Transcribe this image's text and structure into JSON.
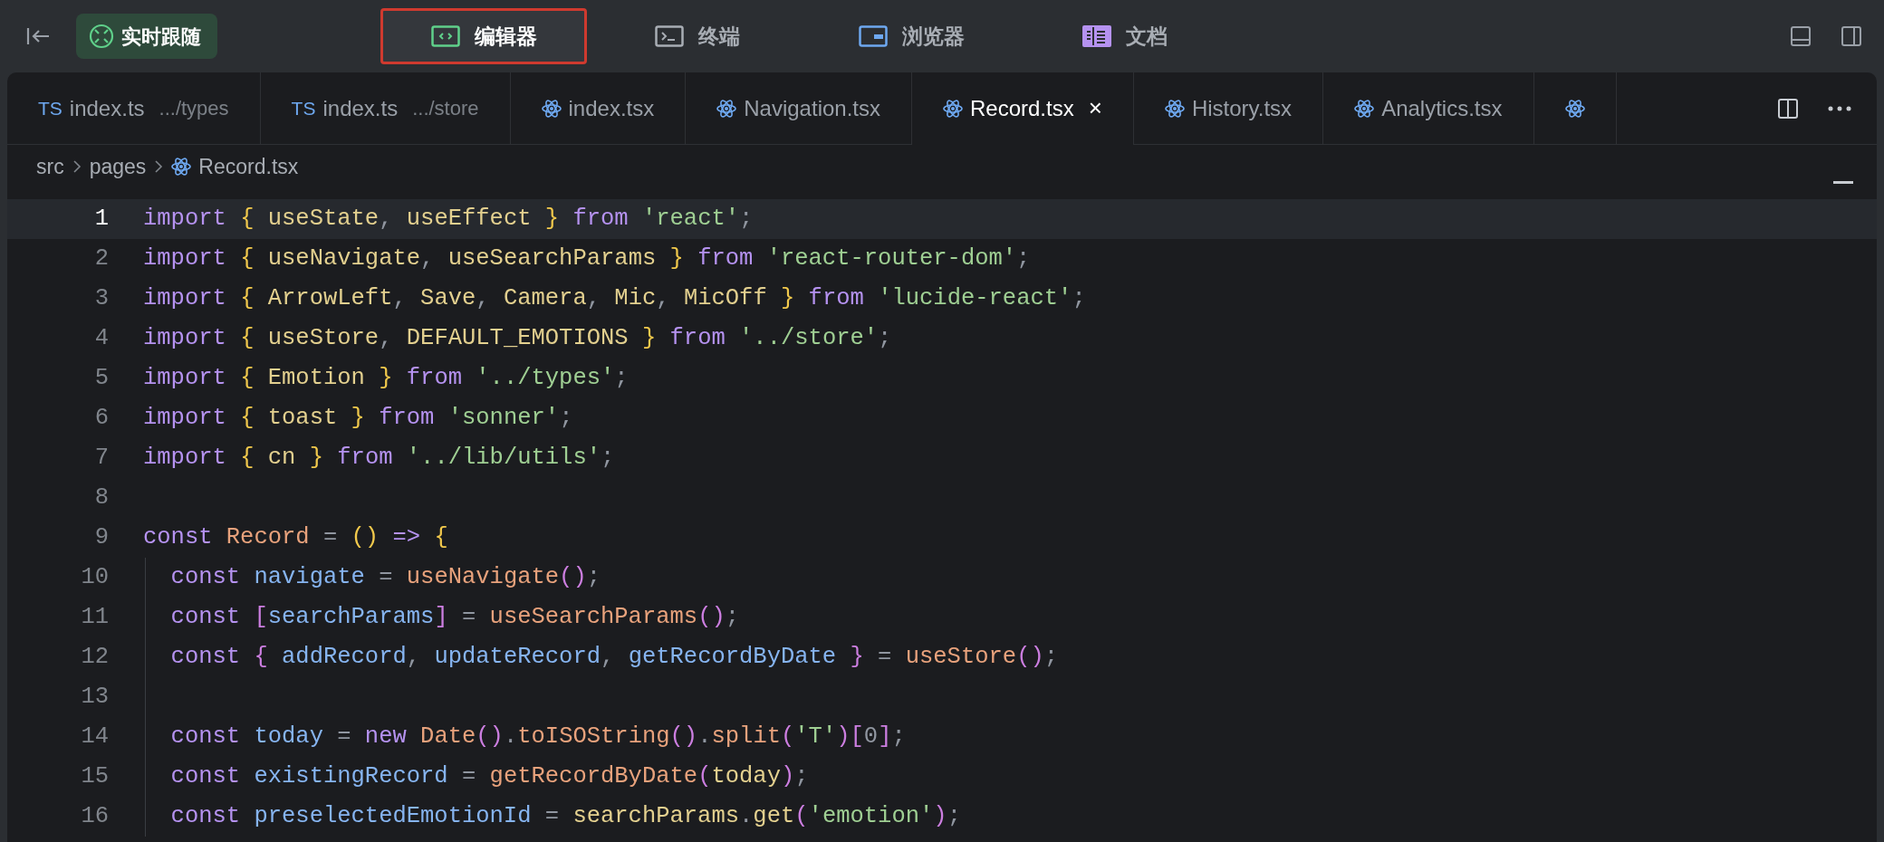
{
  "toolbar": {
    "follow_button": "实时跟随",
    "view_tabs": [
      {
        "kind": "editor",
        "label": "编辑器",
        "selected": true
      },
      {
        "kind": "terminal",
        "label": "终端",
        "selected": false
      },
      {
        "kind": "browser",
        "label": "浏览器",
        "selected": false
      },
      {
        "kind": "docs",
        "label": "文档",
        "selected": false
      }
    ]
  },
  "file_tabs": [
    {
      "kind": "ts",
      "badge": "TS",
      "label": "index.ts",
      "hint": ".../types",
      "selected": false
    },
    {
      "kind": "ts",
      "badge": "TS",
      "label": "index.ts",
      "hint": ".../store",
      "selected": false
    },
    {
      "kind": "react",
      "label": "index.tsx",
      "selected": false
    },
    {
      "kind": "react",
      "label": "Navigation.tsx",
      "selected": false
    },
    {
      "kind": "react",
      "label": "Record.tsx",
      "selected": true,
      "close": "×"
    },
    {
      "kind": "react",
      "label": "History.tsx",
      "selected": false
    },
    {
      "kind": "react",
      "label": "Analytics.tsx",
      "selected": false
    },
    {
      "kind": "react",
      "selected": false
    }
  ],
  "breadcrumb": [
    "src",
    "pages",
    "Record.tsx"
  ],
  "code": [
    {
      "n": "1",
      "selected": true,
      "tokens": [
        {
          "text": "import",
          "kind": "keyword"
        },
        {
          "text": " {",
          "kind": "brace"
        },
        {
          "text": " useState",
          "kind": "name"
        },
        {
          "text": ",",
          "kind": "punct"
        },
        {
          "text": " useEffect",
          "kind": "name"
        },
        {
          "text": " }",
          "kind": "brace"
        },
        {
          "text": " from",
          "kind": "keyword"
        },
        {
          "text": " 'react'",
          "kind": "string"
        },
        {
          "text": ";",
          "kind": "punct"
        }
      ]
    },
    {
      "n": "2",
      "selected": false,
      "tokens": [
        {
          "text": "import",
          "kind": "keyword"
        },
        {
          "text": " {",
          "kind": "brace"
        },
        {
          "text": " useNavigate",
          "kind": "name"
        },
        {
          "text": ",",
          "kind": "punct"
        },
        {
          "text": " useSearchParams",
          "kind": "name"
        },
        {
          "text": " }",
          "kind": "brace"
        },
        {
          "text": " from",
          "kind": "keyword"
        },
        {
          "text": " 'react-router-dom'",
          "kind": "string"
        },
        {
          "text": ";",
          "kind": "punct"
        }
      ]
    },
    {
      "n": "3",
      "selected": false,
      "tokens": [
        {
          "text": "import",
          "kind": "keyword"
        },
        {
          "text": " {",
          "kind": "brace"
        },
        {
          "text": " ArrowLeft",
          "kind": "name"
        },
        {
          "text": ",",
          "kind": "punct"
        },
        {
          "text": " Save",
          "kind": "name"
        },
        {
          "text": ",",
          "kind": "punct"
        },
        {
          "text": " Camera",
          "kind": "name"
        },
        {
          "text": ",",
          "kind": "punct"
        },
        {
          "text": " Mic",
          "kind": "name"
        },
        {
          "text": ",",
          "kind": "punct"
        },
        {
          "text": " MicOff",
          "kind": "name"
        },
        {
          "text": " }",
          "kind": "brace"
        },
        {
          "text": " from",
          "kind": "keyword"
        },
        {
          "text": " 'lucide-react'",
          "kind": "string"
        },
        {
          "text": ";",
          "kind": "punct"
        }
      ]
    },
    {
      "n": "4",
      "selected": false,
      "tokens": [
        {
          "text": "import",
          "kind": "keyword"
        },
        {
          "text": " {",
          "kind": "brace"
        },
        {
          "text": " useStore",
          "kind": "name"
        },
        {
          "text": ",",
          "kind": "punct"
        },
        {
          "text": " DEFAULT_EMOTIONS",
          "kind": "name"
        },
        {
          "text": " }",
          "kind": "brace"
        },
        {
          "text": " from",
          "kind": "keyword"
        },
        {
          "text": " '../store'",
          "kind": "string"
        },
        {
          "text": ";",
          "kind": "punct"
        }
      ]
    },
    {
      "n": "5",
      "selected": false,
      "tokens": [
        {
          "text": "import",
          "kind": "keyword"
        },
        {
          "text": " {",
          "kind": "brace"
        },
        {
          "text": " Emotion",
          "kind": "name"
        },
        {
          "text": " }",
          "kind": "brace"
        },
        {
          "text": " from",
          "kind": "keyword"
        },
        {
          "text": " '../types'",
          "kind": "string"
        },
        {
          "text": ";",
          "kind": "punct"
        }
      ]
    },
    {
      "n": "6",
      "selected": false,
      "tokens": [
        {
          "text": "import",
          "kind": "keyword"
        },
        {
          "text": " {",
          "kind": "brace"
        },
        {
          "text": " toast",
          "kind": "name"
        },
        {
          "text": " }",
          "kind": "brace"
        },
        {
          "text": " from",
          "kind": "keyword"
        },
        {
          "text": " 'sonner'",
          "kind": "string"
        },
        {
          "text": ";",
          "kind": "punct"
        }
      ]
    },
    {
      "n": "7",
      "selected": false,
      "tokens": [
        {
          "text": "import",
          "kind": "keyword"
        },
        {
          "text": " {",
          "kind": "brace"
        },
        {
          "text": " cn",
          "kind": "name"
        },
        {
          "text": " }",
          "kind": "brace"
        },
        {
          "text": " from",
          "kind": "keyword"
        },
        {
          "text": " '../lib/utils'",
          "kind": "string"
        },
        {
          "text": ";",
          "kind": "punct"
        }
      ]
    },
    {
      "n": "8",
      "selected": false
    },
    {
      "n": "9",
      "selected": false,
      "tokens": [
        {
          "text": "const",
          "kind": "keyword"
        },
        {
          "text": " Record",
          "kind": "function"
        },
        {
          "text": " =",
          "kind": "punct"
        },
        {
          "text": " ()",
          "kind": "brace"
        },
        {
          "text": " =>",
          "kind": "keyword"
        },
        {
          "text": " {",
          "kind": "brace"
        }
      ]
    },
    {
      "n": "10",
      "selected": false,
      "tokens": [
        {
          "text": "  const",
          "kind": "keyword"
        },
        {
          "text": " navigate",
          "kind": "variable"
        },
        {
          "text": " =",
          "kind": "punct"
        },
        {
          "text": " useNavigate",
          "kind": "function"
        },
        {
          "text": "()",
          "kind": "bracket"
        },
        {
          "text": ";",
          "kind": "punct"
        }
      ]
    },
    {
      "n": "11",
      "selected": false,
      "tokens": [
        {
          "text": "  const",
          "kind": "keyword"
        },
        {
          "text": " [",
          "kind": "bracket"
        },
        {
          "text": "searchParams",
          "kind": "variable"
        },
        {
          "text": "]",
          "kind": "bracket"
        },
        {
          "text": " =",
          "kind": "punct"
        },
        {
          "text": " useSearchParams",
          "kind": "function"
        },
        {
          "text": "()",
          "kind": "bracket"
        },
        {
          "text": ";",
          "kind": "punct"
        }
      ]
    },
    {
      "n": "12",
      "selected": false,
      "tokens": [
        {
          "text": "  const",
          "kind": "keyword"
        },
        {
          "text": " {",
          "kind": "bracket"
        },
        {
          "text": " addRecord",
          "kind": "variable"
        },
        {
          "text": ",",
          "kind": "punct"
        },
        {
          "text": " updateRecord",
          "kind": "variable"
        },
        {
          "text": ",",
          "kind": "punct"
        },
        {
          "text": " getRecordByDate",
          "kind": "variable"
        },
        {
          "text": " }",
          "kind": "bracket"
        },
        {
          "text": " =",
          "kind": "punct"
        },
        {
          "text": " useStore",
          "kind": "function"
        },
        {
          "text": "()",
          "kind": "bracket"
        },
        {
          "text": ";",
          "kind": "punct"
        }
      ]
    },
    {
      "n": "13",
      "selected": false
    },
    {
      "n": "14",
      "selected": false,
      "tokens": [
        {
          "text": "  const",
          "kind": "keyword"
        },
        {
          "text": " today",
          "kind": "variable"
        },
        {
          "text": " =",
          "kind": "punct"
        },
        {
          "text": " new",
          "kind": "keyword"
        },
        {
          "text": " Date",
          "kind": "function"
        },
        {
          "text": "()",
          "kind": "bracket"
        },
        {
          "text": ".",
          "kind": "punct"
        },
        {
          "text": "toISOString",
          "kind": "function"
        },
        {
          "text": "()",
          "kind": "bracket"
        },
        {
          "text": ".",
          "kind": "punct"
        },
        {
          "text": "split",
          "kind": "function"
        },
        {
          "text": "(",
          "kind": "bracket"
        },
        {
          "text": "'T'",
          "kind": "string"
        },
        {
          "text": ")[",
          "kind": "bracket"
        },
        {
          "text": "0",
          "kind": "punct"
        },
        {
          "text": "]",
          "kind": "bracket"
        },
        {
          "text": ";",
          "kind": "punct"
        }
      ]
    },
    {
      "n": "15",
      "selected": false,
      "tokens": [
        {
          "text": "  const",
          "kind": "keyword"
        },
        {
          "text": " existingRecord",
          "kind": "variable"
        },
        {
          "text": " =",
          "kind": "punct"
        },
        {
          "text": " getRecordByDate",
          "kind": "function"
        },
        {
          "text": "(",
          "kind": "bracket"
        },
        {
          "text": "today",
          "kind": "name"
        },
        {
          "text": ")",
          "kind": "bracket"
        },
        {
          "text": ";",
          "kind": "punct"
        }
      ]
    },
    {
      "n": "16",
      "selected": false,
      "tokens": [
        {
          "text": "  const",
          "kind": "keyword"
        },
        {
          "text": " preselectedEmotionId",
          "kind": "variable"
        },
        {
          "text": " =",
          "kind": "punct"
        },
        {
          "text": " searchParams",
          "kind": "name"
        },
        {
          "text": ".",
          "kind": "punct"
        },
        {
          "text": "get",
          "kind": "name"
        },
        {
          "text": "(",
          "kind": "bracket"
        },
        {
          "text": "'emotion'",
          "kind": "string"
        },
        {
          "text": ")",
          "kind": "bracket"
        },
        {
          "text": ";",
          "kind": "punct"
        }
      ]
    }
  ]
}
